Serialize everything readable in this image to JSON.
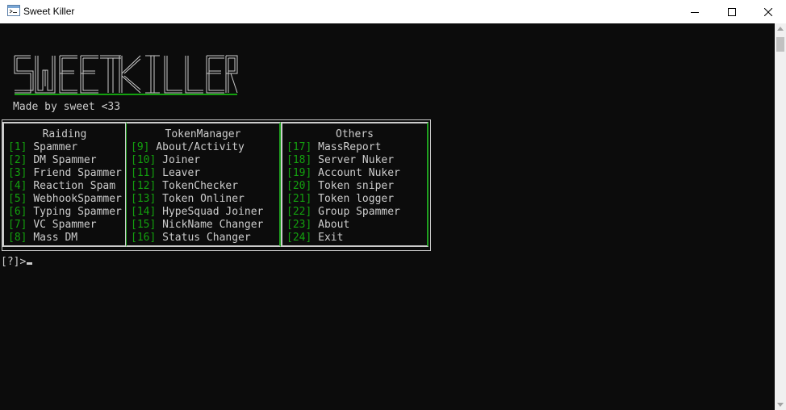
{
  "window": {
    "title": "Sweet Killer"
  },
  "banner": {
    "logo_text": "SWEET KILLER",
    "credit": "Made by sweet <33"
  },
  "columns": [
    {
      "heading": "Raiding",
      "items": [
        {
          "num": "[1]",
          "label": "Spammer"
        },
        {
          "num": "[2]",
          "label": "DM Spammer"
        },
        {
          "num": "[3]",
          "label": "Friend Spammer"
        },
        {
          "num": "[4]",
          "label": "Reaction Spam"
        },
        {
          "num": "[5]",
          "label": "WebhookSpammer"
        },
        {
          "num": "[6]",
          "label": "Typing Spammer"
        },
        {
          "num": "[7]",
          "label": "VC Spammer"
        },
        {
          "num": "[8]",
          "label": "Mass DM"
        }
      ]
    },
    {
      "heading": "TokenManager",
      "items": [
        {
          "num": "[9]",
          "label": "About/Activity"
        },
        {
          "num": "[10]",
          "label": "Joiner"
        },
        {
          "num": "[11]",
          "label": "Leaver"
        },
        {
          "num": "[12]",
          "label": "TokenChecker"
        },
        {
          "num": "[13]",
          "label": "Token Onliner"
        },
        {
          "num": "[14]",
          "label": "HypeSquad Joiner"
        },
        {
          "num": "[15]",
          "label": "NickName Changer"
        },
        {
          "num": "[16]",
          "label": "Status Changer"
        }
      ]
    },
    {
      "heading": "Others",
      "items": [
        {
          "num": "[17]",
          "label": "MassReport"
        },
        {
          "num": "[18]",
          "label": "Server Nuker"
        },
        {
          "num": "[19]",
          "label": "Account Nuker"
        },
        {
          "num": "[20]",
          "label": "Token sniper"
        },
        {
          "num": "[21]",
          "label": "Token logger"
        },
        {
          "num": "[22]",
          "label": "Group Spammer"
        },
        {
          "num": "[23]",
          "label": "About"
        },
        {
          "num": "[24]",
          "label": "Exit"
        }
      ]
    }
  ],
  "prompt": "[?]>",
  "colors": {
    "background": "#0c0c0c",
    "text": "#cccccc",
    "accent_green": "#13a10e"
  }
}
